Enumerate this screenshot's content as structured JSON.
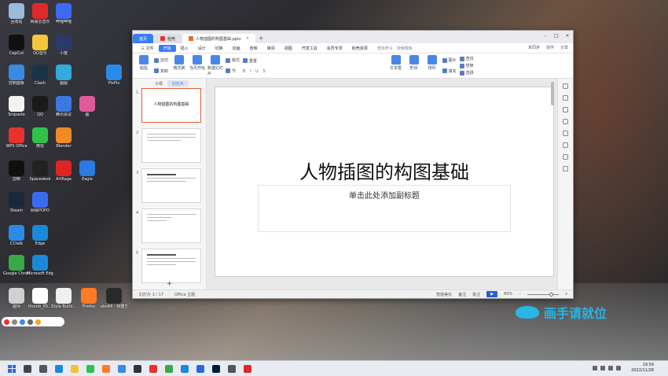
{
  "desktop": {
    "icons": [
      {
        "label": "回收站",
        "color": "#9bbbd8"
      },
      {
        "label": "网易云音乐",
        "color": "#e0292b"
      },
      {
        "label": "哔哩哔哩",
        "color": "#3a6cf4"
      },
      {
        "label": "CapCut",
        "color": "#111111"
      },
      {
        "label": "QQ音乐",
        "color": "#f6c53a"
      },
      {
        "label": "小窗",
        "color": "#2c3a6a"
      },
      {
        "label": "控制面板",
        "color": "#3a8ae0"
      },
      {
        "label": "Clash",
        "color": "#1a3348"
      },
      {
        "label": "画图",
        "color": "#33aadd"
      },
      {
        "label": "PixPix",
        "color": "#2a8ae8"
      },
      {
        "label": "Snipaste",
        "color": "#f2f2f2"
      },
      {
        "label": "QQ",
        "color": "#1a1a1a"
      },
      {
        "label": "腾讯会议",
        "color": "#3a7ae0"
      },
      {
        "label": "图",
        "color": "#e05a9a"
      },
      {
        "label": "WPS Office",
        "color": "#e8322f"
      },
      {
        "label": "微信",
        "color": "#2ec24a"
      },
      {
        "label": "Blender",
        "color": "#f08a24"
      },
      {
        "label": "剪映",
        "color": "#101010"
      },
      {
        "label": "Spacedesk",
        "color": "#222222"
      },
      {
        "label": "ArtRage",
        "color": "#e02424"
      },
      {
        "label": "Eagle",
        "color": "#2a7ae0"
      },
      {
        "label": "Steam",
        "color": "#1b2838"
      },
      {
        "label": "网易POPO",
        "color": "#3a6af0"
      },
      {
        "label": "CCtalk",
        "color": "#2a8ae8"
      },
      {
        "label": "Edge",
        "color": "#1a8ad8"
      },
      {
        "label": "Google Chrome",
        "color": "#3aa84a"
      },
      {
        "label": "Microsoft Edge",
        "color": "#1a8ad8"
      },
      {
        "label": "thumb_65...",
        "color": "#ffffff"
      },
      {
        "label": "Style Build...",
        "color": "#f0f0f0"
      },
      {
        "label": "Firefox",
        "color": "#ff7a24"
      },
      {
        "label": "obs64 - 快捷方式",
        "color": "#2a2a2a"
      },
      {
        "label": "画师",
        "color": "#d0d0d0"
      }
    ]
  },
  "window": {
    "tabs": {
      "home": "首页",
      "shell": "稻壳",
      "doc": "人物插图的构图基础.pptx",
      "doc_close": "×",
      "add": "+"
    },
    "controls": {
      "min": "–",
      "max": "□",
      "close": "×"
    },
    "menu": {
      "file": "三 文件",
      "start": "开始",
      "insert": "插入",
      "design": "设计",
      "switch": "切换",
      "animation": "动画",
      "show": "放映",
      "review": "审阅",
      "view": "视图",
      "dev": "开发工具",
      "member": "会员专享",
      "resource": "稻壳资源",
      "search": "查找命令、搜索模板",
      "sync": "未同步",
      "collab": "协作",
      "share": "分享"
    },
    "ribbon": {
      "paste": "粘贴",
      "cut": "剪切",
      "copy": "复制",
      "format_painter": "格式刷",
      "from_current": "当页开始",
      "new_slide": "新建幻灯片",
      "layout": "版式",
      "section": "节",
      "reset": "重置",
      "text_box": "文本框",
      "shape": "形状",
      "arrange": "排列",
      "picture": "图片",
      "fill": "填充",
      "find": "查找",
      "replace": "替换",
      "select": "选择"
    },
    "pane": {
      "tab_outline": "大纲",
      "tab_slides": "幻灯片",
      "add": "+",
      "thumbs": [
        {
          "num": "1",
          "title": "人物插图的构图基础"
        },
        {
          "num": "2",
          "title": ""
        },
        {
          "num": "3",
          "title": ""
        },
        {
          "num": "4",
          "title": ""
        },
        {
          "num": "5",
          "title": ""
        }
      ]
    },
    "slide": {
      "title": "人物插图的构图基础",
      "subtitle_placeholder": "单击此处添加副标题"
    },
    "status": {
      "slide_count": "幻灯片 1 / 17",
      "theme": "Office 主题",
      "smart_beautify": "智能美化",
      "notes": "备注",
      "comments": "批注",
      "play": "▶",
      "zoom": "80%",
      "zoom_minus": "–",
      "zoom_plus": "+"
    }
  },
  "watermark": {
    "text": "画手请就位"
  },
  "taskbar": {
    "time": "19:59",
    "date": "2022/11/28"
  }
}
